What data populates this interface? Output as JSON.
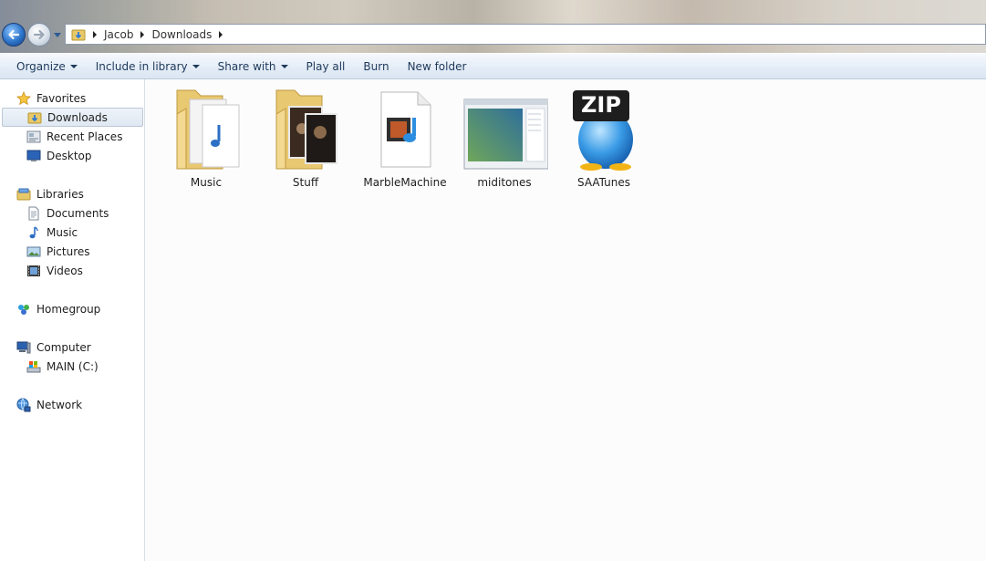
{
  "address": {
    "crumbs": [
      "Jacob",
      "Downloads"
    ]
  },
  "commands": [
    {
      "label": "Organize",
      "dropdown": true
    },
    {
      "label": "Include in library",
      "dropdown": true
    },
    {
      "label": "Share with",
      "dropdown": true
    },
    {
      "label": "Play all",
      "dropdown": false
    },
    {
      "label": "Burn",
      "dropdown": false
    },
    {
      "label": "New folder",
      "dropdown": false
    }
  ],
  "nav": {
    "favorites": "Favorites",
    "downloads": "Downloads",
    "recent_places": "Recent Places",
    "desktop": "Desktop",
    "libraries": "Libraries",
    "documents": "Documents",
    "music": "Music",
    "pictures": "Pictures",
    "videos": "Videos",
    "homegroup": "Homegroup",
    "computer": "Computer",
    "main_drive": "MAIN (C:)",
    "network": "Network"
  },
  "files": [
    {
      "name": "Music",
      "icon": "music-folder-icon"
    },
    {
      "name": "Stuff",
      "icon": "picture-folder-icon"
    },
    {
      "name": "MarbleMachine",
      "icon": "video-file-icon"
    },
    {
      "name": "miditones",
      "icon": "window-app-icon"
    },
    {
      "name": "SAATunes",
      "icon": "zip-archive-icon"
    }
  ],
  "zip_badge": "ZIP"
}
